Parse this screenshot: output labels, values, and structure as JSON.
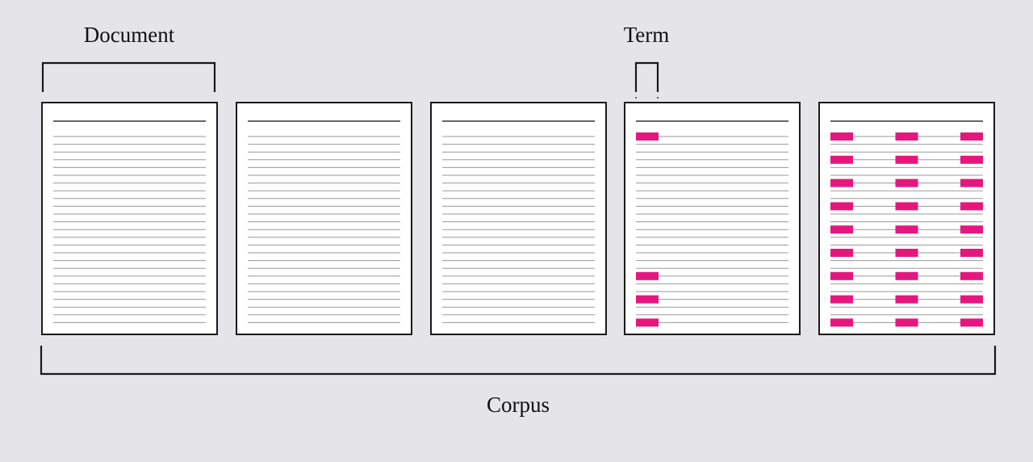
{
  "labels": {
    "document": "Document",
    "term": "Term",
    "corpus": "Corpus"
  },
  "colors": {
    "background": "#e5e5e7",
    "page": "#ffffff",
    "stroke": "#1a1a1a",
    "rule": "#9a9a9a",
    "term_highlight": "#e5177e"
  },
  "documents": [
    {
      "id": "doc-1",
      "highlighted_lines": [],
      "highlight_columns": []
    },
    {
      "id": "doc-2",
      "highlighted_lines": [],
      "highlight_columns": []
    },
    {
      "id": "doc-3",
      "highlighted_lines": [],
      "highlight_columns": []
    },
    {
      "id": "doc-4",
      "highlighted_lines": [
        1,
        19,
        22,
        25
      ],
      "highlight_columns": [
        "left"
      ]
    },
    {
      "id": "doc-5",
      "highlighted_lines": [
        1,
        4,
        7,
        10,
        13,
        16,
        19,
        22,
        25
      ],
      "highlight_columns": [
        "left",
        "center",
        "right"
      ]
    }
  ]
}
